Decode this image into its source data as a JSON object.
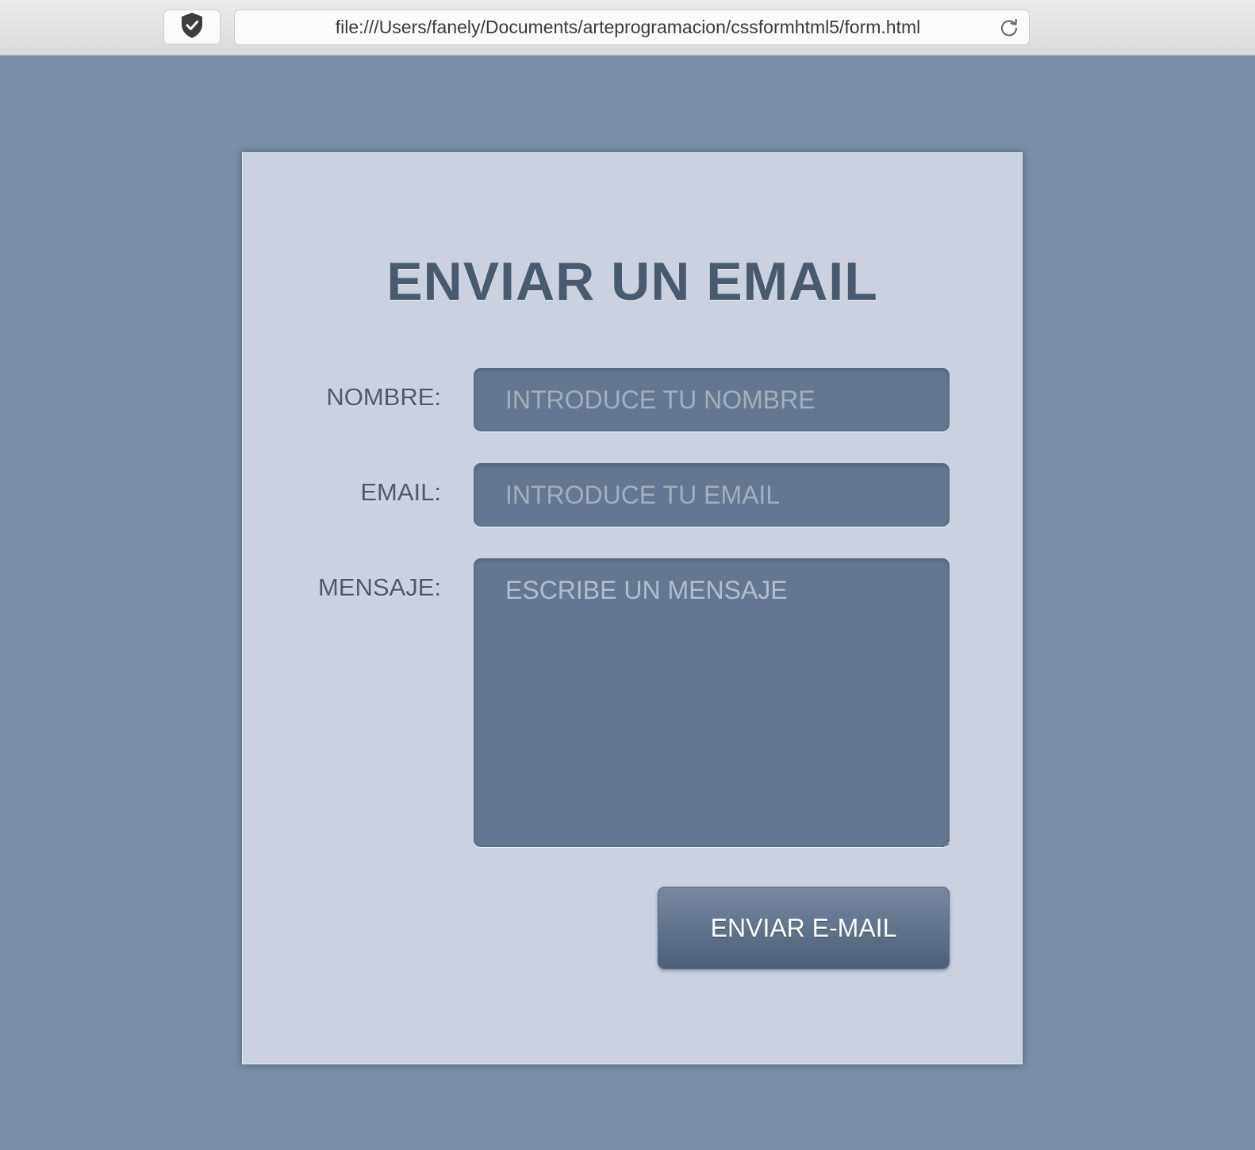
{
  "browser": {
    "url": "file:///Users/fanely/Documents/arteprogramacion/cssformhtml5/form.html",
    "shield_icon": "shield-check-icon",
    "reload_icon": "reload-icon"
  },
  "form": {
    "title": "ENVIAR UN EMAIL",
    "nombre": {
      "label": "NOMBRE:",
      "placeholder": "INTRODUCE TU NOMBRE",
      "value": ""
    },
    "email": {
      "label": "EMAIL:",
      "placeholder": "INTRODUCE TU EMAIL",
      "value": ""
    },
    "mensaje": {
      "label": "MENSAJE:",
      "placeholder": "ESCRIBE UN MENSAJE",
      "value": ""
    },
    "submit_label": "ENVIAR E-MAIL"
  },
  "colors": {
    "page_background": "#7a8fa7",
    "card_background": "#cbd1df",
    "field_background": "#657790",
    "title_color": "#4a5a6e",
    "button_top": "#7888a0",
    "button_bottom": "#4d5e79"
  }
}
